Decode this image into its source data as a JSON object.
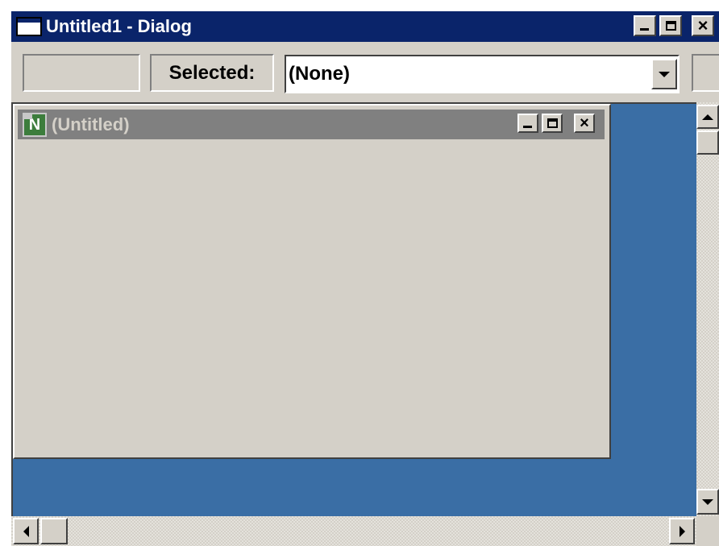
{
  "window": {
    "title": "Untitled1 - Dialog",
    "controls": [
      "minimize",
      "maximize",
      "close"
    ]
  },
  "toolbar": {
    "status_text": "",
    "selected_label": "Selected:",
    "selection_value": "(None)"
  },
  "child_window": {
    "title": "(Untitled)",
    "icon_letter": "N",
    "controls": [
      "minimize",
      "maximize",
      "close"
    ]
  },
  "colors": {
    "active_titlebar": "#0a246a",
    "inactive_titlebar": "#808080",
    "mdi_background": "#3a6ea5",
    "face": "#d4d0c8"
  },
  "icons": {
    "app": "dialog-window-icon",
    "child": "n-document-icon",
    "close_glyph": "×"
  }
}
